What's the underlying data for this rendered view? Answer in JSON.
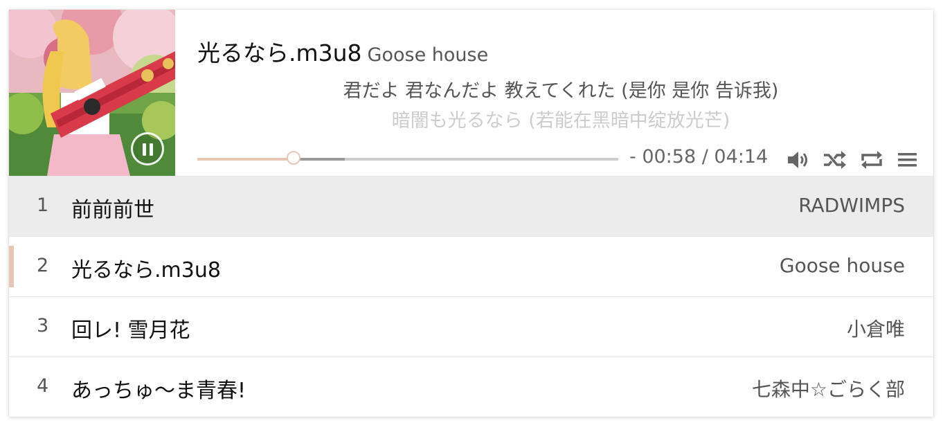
{
  "now_playing": {
    "title": "光るなら.m3u8",
    "artist": "Goose house",
    "cover_icon": "album-cover-image",
    "state": "playing"
  },
  "lyrics": {
    "current": "君だよ 君なんだよ 教えてくれた (是你 是你 告诉我)",
    "next": "暗闇も光るなら (若能在黑暗中绽放光芒)"
  },
  "progress": {
    "time_display": "- 00:58 / 04:14",
    "played_fraction": 0.228,
    "loaded_fraction": 0.35
  },
  "controls": {
    "volume_icon": "volume-icon",
    "shuffle_icon": "shuffle-icon",
    "repeat_icon": "repeat-icon",
    "menu_icon": "menu-icon"
  },
  "colors": {
    "accent": "#e8c6b6",
    "hover_row": "#ececec",
    "loaded_bar": "#999999",
    "track_bar": "#cdcdcd"
  },
  "playlist": [
    {
      "index": "1",
      "title": "前前前世",
      "artist": "RADWIMPS",
      "state": "hover"
    },
    {
      "index": "2",
      "title": "光るなら.m3u8",
      "artist": "Goose house",
      "state": "active"
    },
    {
      "index": "3",
      "title": "回レ! 雪月花",
      "artist": "小倉唯",
      "state": ""
    },
    {
      "index": "4",
      "title": "あっちゅ～ま青春!",
      "artist": "七森中☆ごらく部",
      "state": ""
    }
  ]
}
